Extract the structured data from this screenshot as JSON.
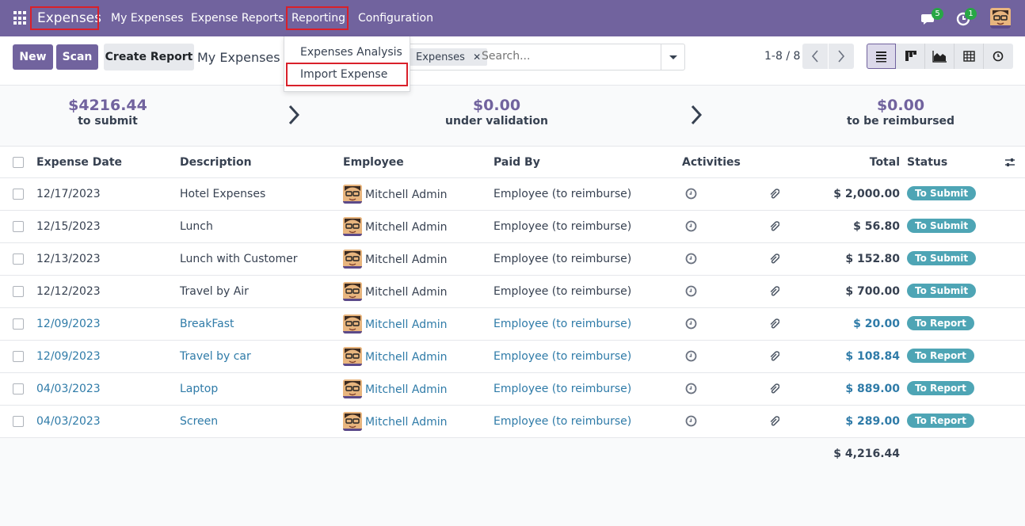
{
  "navbar": {
    "brand": "Expenses",
    "menu": [
      "My Expenses",
      "Expense Reports",
      "Reporting",
      "Configuration"
    ],
    "messages_count": "5",
    "activities_count": "1"
  },
  "dropdown": {
    "items": [
      "Expenses Analysis",
      "Import Expense"
    ]
  },
  "control": {
    "new_label": "New",
    "scan_label": "Scan",
    "create_report_label": "Create Report",
    "breadcrumb": "My Expenses",
    "facet": "Expenses",
    "search_placeholder": "Search...",
    "pager": "1-8 / 8"
  },
  "summary": [
    {
      "value": "$4216.44",
      "label": "to submit"
    },
    {
      "value": "$0.00",
      "label": "under validation"
    },
    {
      "value": "$0.00",
      "label": "to be reimbursed"
    }
  ],
  "table": {
    "headers": {
      "date": "Expense Date",
      "description": "Description",
      "employee": "Employee",
      "paid_by": "Paid By",
      "activities": "Activities",
      "total": "Total",
      "status": "Status"
    },
    "rows": [
      {
        "date": "12/17/2023",
        "description": "Hotel Expenses",
        "employee": "Mitchell Admin",
        "paid_by": "Employee (to reimburse)",
        "total": "$ 2,000.00",
        "status": "To Submit"
      },
      {
        "date": "12/15/2023",
        "description": "Lunch",
        "employee": "Mitchell Admin",
        "paid_by": "Employee (to reimburse)",
        "total": "$ 56.80",
        "status": "To Submit"
      },
      {
        "date": "12/13/2023",
        "description": "Lunch with Customer",
        "employee": "Mitchell Admin",
        "paid_by": "Employee (to reimburse)",
        "total": "$ 152.80",
        "status": "To Submit"
      },
      {
        "date": "12/12/2023",
        "description": "Travel by Air",
        "employee": "Mitchell Admin",
        "paid_by": "Employee (to reimburse)",
        "total": "$ 700.00",
        "status": "To Submit"
      },
      {
        "date": "12/09/2023",
        "description": "BreakFast",
        "employee": "Mitchell Admin",
        "paid_by": "Employee (to reimburse)",
        "total": "$ 20.00",
        "status": "To Report"
      },
      {
        "date": "12/09/2023",
        "description": "Travel by car",
        "employee": "Mitchell Admin",
        "paid_by": "Employee (to reimburse)",
        "total": "$ 108.84",
        "status": "To Report"
      },
      {
        "date": "04/03/2023",
        "description": "Laptop",
        "employee": "Mitchell Admin",
        "paid_by": "Employee (to reimburse)",
        "total": "$ 889.00",
        "status": "To Report"
      },
      {
        "date": "04/03/2023",
        "description": "Screen",
        "employee": "Mitchell Admin",
        "paid_by": "Employee (to reimburse)",
        "total": "$ 289.00",
        "status": "To Report"
      }
    ],
    "grand_total": "$ 4,216.44"
  }
}
